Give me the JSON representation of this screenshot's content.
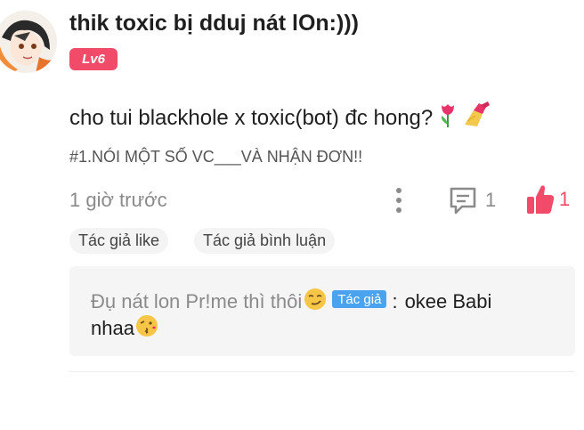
{
  "post": {
    "author_name": "thik toxic bị dduj nát lOn:)))",
    "level_badge": "Lv6",
    "body_text": "cho tui blackhole x toxic(bot) đc hong?",
    "hashtag": "#1.NÓI MỘT SỐ VC___VÀ NHẬN ĐƠN!!",
    "timestamp": "1 giờ trước",
    "comment_count": "1",
    "like_count": "1",
    "tags": [
      "Tác giả like",
      "Tác giả bình luận"
    ]
  },
  "reply": {
    "author": "Đụ nát lon Pr!me thì thôi",
    "author_badge": "Tác giả",
    "separator": ":",
    "text_part1": "okee Babi",
    "text_part2": "nhaa"
  },
  "icons": {
    "more": "vertical-dots-icon",
    "comment": "comment-bubble-icon",
    "like": "thumbs-up-icon",
    "body_emojis": [
      "tulip-emoji",
      "nail-polish-emoji"
    ],
    "author_emoji": "smirk-emoji",
    "reply_emoji": "kissing-face-emoji"
  },
  "colors": {
    "accent": "#f24b6a",
    "author_badge": "#4aa3f0",
    "muted_text": "#8a8a8a",
    "reply_background": "#f5f5f5"
  }
}
